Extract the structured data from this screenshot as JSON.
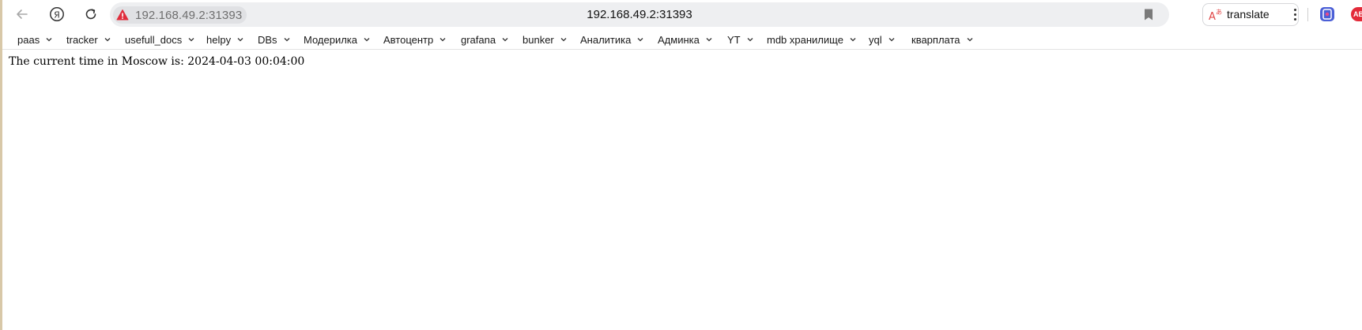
{
  "toolbar": {
    "back_icon": "back-arrow-icon",
    "yandex_icon": "yandex-logo-icon",
    "reload_icon": "reload-icon",
    "site_badge_text": "192.168.49.2:31393",
    "address_title": "192.168.49.2:31393",
    "bookmark_icon": "bookmark-icon",
    "translate_label": "translate",
    "menu_icon": "kebab-menu-icon",
    "extension_2_label": "AB"
  },
  "bookmarks": [
    {
      "label": "paas"
    },
    {
      "label": "tracker"
    },
    {
      "label": "usefull_docs"
    },
    {
      "label": "helpy"
    },
    {
      "label": "DBs"
    },
    {
      "label": "Модерилка"
    },
    {
      "label": "Автоцентр"
    },
    {
      "label": "grafana"
    },
    {
      "label": "bunker"
    },
    {
      "label": "Аналитика"
    },
    {
      "label": "Админка"
    },
    {
      "label": "YT"
    },
    {
      "label": "mdb хранилище"
    },
    {
      "label": "yql"
    },
    {
      "label": "кварплата"
    }
  ],
  "page": {
    "text": "The current time in Moscow is: 2024-04-03 00:04:00"
  },
  "colors": {
    "warning": "#e02d3c",
    "omnibox_bg": "#eeeff1",
    "extension_red": "#e32b3a"
  }
}
